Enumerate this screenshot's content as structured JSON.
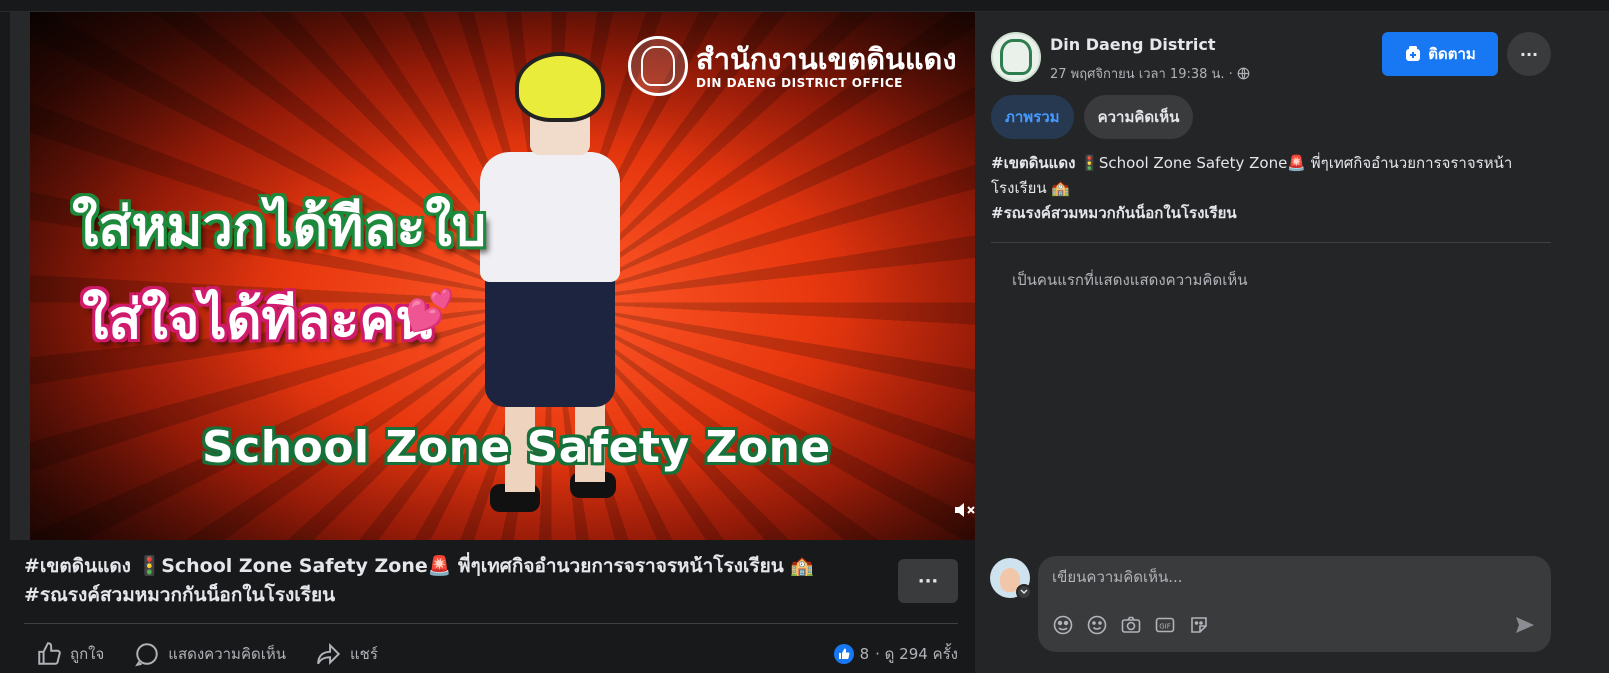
{
  "video": {
    "logo_th": "สำนักงานเขตดินแดง",
    "logo_en": "DIN DAENG DISTRICT OFFICE",
    "line1": "ใส่หมวกได้ทีละใบ",
    "line2": "ใส่ใจได้ทีละคน",
    "slogan": "School Zone Safety Zone",
    "heart_emoji": "💕"
  },
  "post": {
    "title": "#เขตดินแดง 🚦School Zone Safety Zone🚨 พี่ๆเทศกิจอำนวยการจราจรหน้าโรงเรียน 🏫 #รณรงค์สวมหมวกกันน็อกในโรงเรียน",
    "more": "···",
    "actions": {
      "like": "ถูกใจ",
      "comment": "แสดงความคิดเห็น",
      "share": "แชร์"
    },
    "like_count": "8",
    "views": "· ดู 294 ครั้ง"
  },
  "page": {
    "name": "Din Daeng District",
    "timestamp": "27 พฤศจิกายน เวลา 19:38 น. ·",
    "follow": "ติดตาม",
    "more": "···"
  },
  "tabs": [
    {
      "label": "ภาพรวม",
      "active": true
    },
    {
      "label": "ความคิดเห็น",
      "active": false
    }
  ],
  "description": {
    "line1_bold": "#เขตดินแดง",
    "line1_rest": " 🚦School Zone Safety Zone🚨 พี่ๆเทศกิจอำนวยการจราจรหน้าโรงเรียน 🏫",
    "line2_bold": "#รณรงค์สวมหมวกกันน็อกในโรงเรียน"
  },
  "comments": {
    "empty_text": "เป็นคนแรกที่แสดงแสดงความคิดเห็น",
    "placeholder": "เขียนความคิดเห็น..."
  },
  "colors": {
    "accent": "#1877f2",
    "background": "#18191a",
    "panel": "#242526"
  },
  "icons": [
    "mute-icon",
    "like-icon",
    "comment-icon",
    "share-icon",
    "globe-icon",
    "follow-icon",
    "avatar-icon",
    "emoji-icon",
    "camera-icon",
    "gif-icon",
    "sticker-icon",
    "send-icon"
  ]
}
